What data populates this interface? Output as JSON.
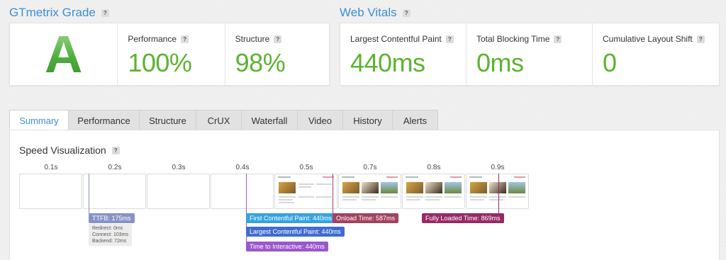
{
  "grade_section": {
    "title": "GTmetrix Grade",
    "grade": "A",
    "metrics": [
      {
        "label": "Performance",
        "value": "100%"
      },
      {
        "label": "Structure",
        "value": "98%"
      }
    ]
  },
  "web_vitals": {
    "title": "Web Vitals",
    "metrics": [
      {
        "label": "Largest Contentful Paint",
        "value": "440ms"
      },
      {
        "label": "Total Blocking Time",
        "value": "0ms"
      },
      {
        "label": "Cumulative Layout Shift",
        "value": "0"
      }
    ]
  },
  "help_glyph": "?",
  "tabs": [
    "Summary",
    "Performance",
    "Structure",
    "CrUX",
    "Waterfall",
    "Video",
    "History",
    "Alerts"
  ],
  "active_tab": "Summary",
  "speed_viz": {
    "title": "Speed Visualization",
    "ticks": [
      "0.1s",
      "0.2s",
      "0.3s",
      "0.4s",
      "0.5s",
      "0.7s",
      "0.8s",
      "0.9s"
    ],
    "ttfb": {
      "label": "TTFB: 175ms",
      "details": [
        "Redirect: 0ms",
        "Connect: 103ms",
        "Backend: 72ms"
      ]
    },
    "markers": {
      "fcp": "First Contentful Paint: 440ms",
      "lcp": "Largest Contentful Paint: 440ms",
      "tti": "Time to Interactive: 440ms",
      "onload": "Onload Time: 587ms",
      "fully_loaded": "Fully Loaded Time: 869ms"
    }
  },
  "colors": {
    "accent": "#3b8fd6",
    "good": "#5cb330",
    "ttfb": "#8793c4",
    "fcp": "#35a3e0",
    "lcp": "#3f6ccf",
    "tti": "#9b57cc",
    "onload": "#a3415f",
    "fully_loaded": "#962a63"
  }
}
